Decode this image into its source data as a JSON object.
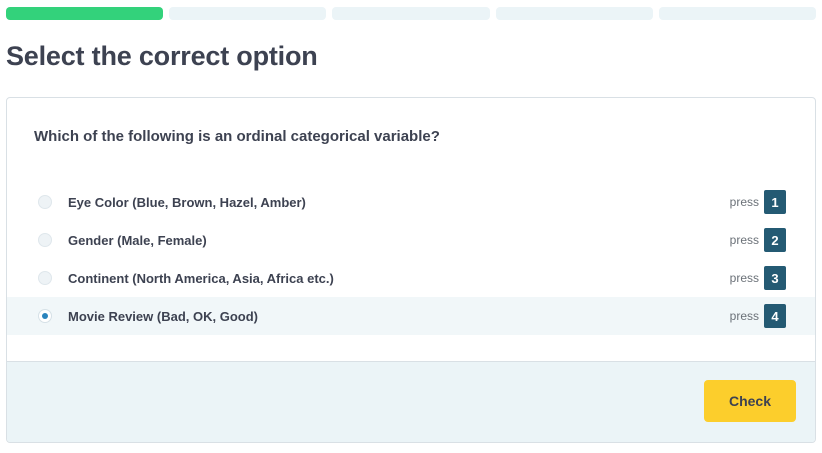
{
  "progress": {
    "completed": 1,
    "total": 5
  },
  "page_title": "Select the correct option",
  "question": "Which of the following is an ordinal categorical variable?",
  "options": [
    {
      "label": "Eye Color (Blue, Brown, Hazel, Amber)",
      "press": "press",
      "key": "1",
      "selected": false
    },
    {
      "label": "Gender (Male, Female)",
      "press": "press",
      "key": "2",
      "selected": false
    },
    {
      "label": "Continent (North America, Asia, Africa etc.)",
      "press": "press",
      "key": "3",
      "selected": false
    },
    {
      "label": "Movie Review (Bad, OK, Good)",
      "press": "press",
      "key": "4",
      "selected": true
    }
  ],
  "check_button": "Check",
  "colors": {
    "progress_done": "#33d27b",
    "accent_button": "#fcce2c",
    "key_badge": "#245a73",
    "radio_selected": "#2a84bd"
  }
}
